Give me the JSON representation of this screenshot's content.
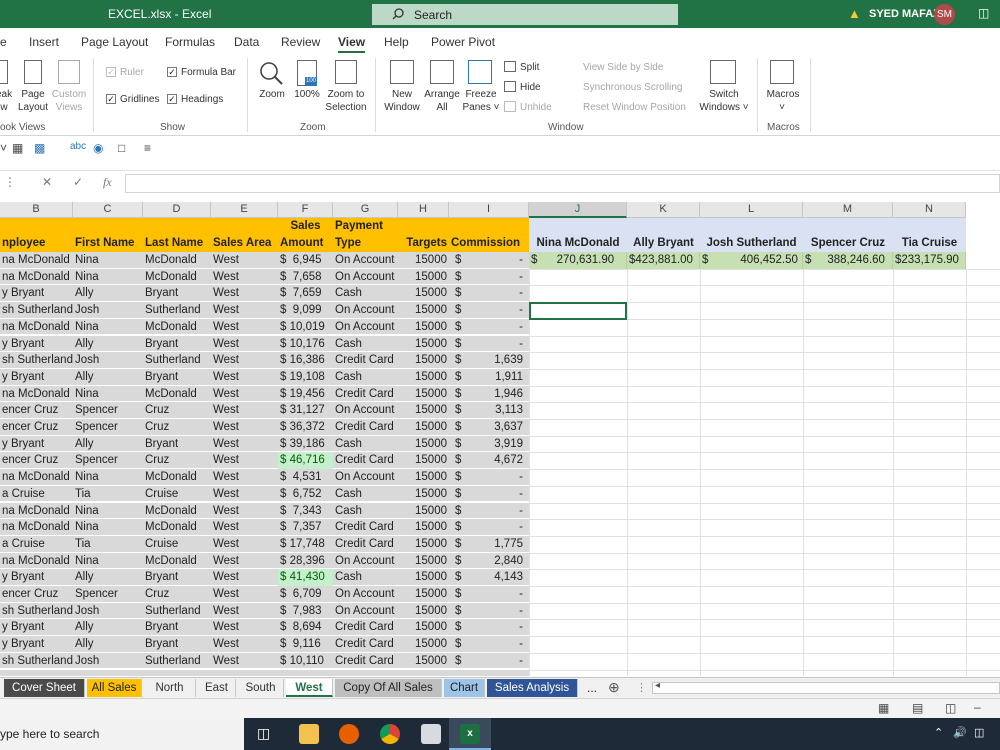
{
  "window": {
    "title": "EXCEL.xlsx  -  Excel",
    "search_placeholder": "Search",
    "user_name": "SYED MAFAZ",
    "user_initials": "SM"
  },
  "menu": [
    "e",
    "Insert",
    "Page Layout",
    "Formulas",
    "Data",
    "Review",
    "View",
    "Help",
    "Power Pivot"
  ],
  "ribbon": {
    "workbook_views": {
      "break_label": "eak\nw",
      "page_layout": "Page\nLayout",
      "custom_views": "Custom\nViews",
      "group": "ook Views"
    },
    "show": {
      "ruler": "Ruler",
      "formula_bar": "Formula Bar",
      "gridlines": "Gridlines",
      "headings": "Headings",
      "group": "Show"
    },
    "zoom": {
      "zoom": "Zoom",
      "hundred": "100%",
      "zoom_sel": "Zoom to\nSelection",
      "group": "Zoom"
    },
    "window": {
      "new_window": "New\nWindow",
      "arrange_all": "Arrange\nAll",
      "freeze": "Freeze\nPanes ˅",
      "split": "Split",
      "hide": "Hide",
      "unhide": "Unhide",
      "side_by_side": "View Side by Side",
      "sync_scroll": "Synchronous Scrolling",
      "reset_pos": "Reset Window Position",
      "switch": "Switch\nWindows ˅",
      "group": "Window"
    },
    "macros": {
      "macros": "Macros",
      "group": "Macros"
    }
  },
  "formula_bar": {
    "cancel": "✕",
    "enter": "✓",
    "fx": "fx"
  },
  "columns": [
    "B",
    "C",
    "D",
    "E",
    "F",
    "G",
    "H",
    "I",
    "J",
    "K",
    "L",
    "M",
    "N"
  ],
  "header1": {
    "sales": "Sales",
    "payment": "Payment"
  },
  "header2": [
    "nployee",
    "First Name",
    "Last Name",
    "Sales Area",
    "Amount",
    "Type",
    "Targets",
    "Commission"
  ],
  "summary": {
    "names": [
      "Nina McDonald",
      "Ally Bryant",
      "Josh Sutherland",
      "Spencer Cruz",
      "Tia Cruise"
    ],
    "values": [
      "$      270,631.90",
      "$423,881.00",
      "$          406,452.50",
      "$     388,246.60",
      "$233,175.90"
    ]
  },
  "rows": [
    [
      "na McDonald",
      "Nina",
      "McDonald",
      "West",
      "$  6,945",
      "On Account",
      "15000",
      "$",
      "-"
    ],
    [
      "na McDonald",
      "Nina",
      "McDonald",
      "West",
      "$  7,658",
      "On Account",
      "15000",
      "$",
      "-"
    ],
    [
      "y Bryant",
      "Ally",
      "Bryant",
      "West",
      "$  7,659",
      "Cash",
      "15000",
      "$",
      "-"
    ],
    [
      "sh Sutherland",
      "Josh",
      "Sutherland",
      "West",
      "$  9,099",
      "On Account",
      "15000",
      "$",
      "-"
    ],
    [
      "na McDonald",
      "Nina",
      "McDonald",
      "West",
      "$ 10,019",
      "On Account",
      "15000",
      "$",
      "-"
    ],
    [
      "y Bryant",
      "Ally",
      "Bryant",
      "West",
      "$ 10,176",
      "Cash",
      "15000",
      "$",
      "-"
    ],
    [
      "sh Sutherland",
      "Josh",
      "Sutherland",
      "West",
      "$ 16,386",
      "Credit Card",
      "15000",
      "$",
      "1,639"
    ],
    [
      "y Bryant",
      "Ally",
      "Bryant",
      "West",
      "$ 19,108",
      "Cash",
      "15000",
      "$",
      "1,911"
    ],
    [
      "na McDonald",
      "Nina",
      "McDonald",
      "West",
      "$ 19,456",
      "Credit Card",
      "15000",
      "$",
      "1,946"
    ],
    [
      "encer Cruz",
      "Spencer",
      "Cruz",
      "West",
      "$ 31,127",
      "On Account",
      "15000",
      "$",
      "3,113"
    ],
    [
      "encer Cruz",
      "Spencer",
      "Cruz",
      "West",
      "$ 36,372",
      "Credit Card",
      "15000",
      "$",
      "3,637"
    ],
    [
      "y Bryant",
      "Ally",
      "Bryant",
      "West",
      "$ 39,186",
      "Cash",
      "15000",
      "$",
      "3,919"
    ],
    [
      "encer Cruz",
      "Spencer",
      "Cruz",
      "West",
      "$ 46,716",
      "Credit Card",
      "15000",
      "$",
      "4,672"
    ],
    [
      "na McDonald",
      "Nina",
      "McDonald",
      "West",
      "$  4,531",
      "On Account",
      "15000",
      "$",
      "-"
    ],
    [
      "a Cruise",
      "Tia",
      "Cruise",
      "West",
      "$  6,752",
      "Cash",
      "15000",
      "$",
      "-"
    ],
    [
      "na McDonald",
      "Nina",
      "McDonald",
      "West",
      "$  7,343",
      "Cash",
      "15000",
      "$",
      "-"
    ],
    [
      "na McDonald",
      "Nina",
      "McDonald",
      "West",
      "$  7,357",
      "Credit Card",
      "15000",
      "$",
      "-"
    ],
    [
      "a Cruise",
      "Tia",
      "Cruise",
      "West",
      "$ 17,748",
      "Credit Card",
      "15000",
      "$",
      "1,775"
    ],
    [
      "na McDonald",
      "Nina",
      "McDonald",
      "West",
      "$ 28,396",
      "On Account",
      "15000",
      "$",
      "2,840"
    ],
    [
      "y Bryant",
      "Ally",
      "Bryant",
      "West",
      "$ 41,430",
      "Cash",
      "15000",
      "$",
      "4,143"
    ],
    [
      "encer Cruz",
      "Spencer",
      "Cruz",
      "West",
      "$  6,709",
      "On Account",
      "15000",
      "$",
      "-"
    ],
    [
      "sh Sutherland",
      "Josh",
      "Sutherland",
      "West",
      "$  7,983",
      "On Account",
      "15000",
      "$",
      "-"
    ],
    [
      "y Bryant",
      "Ally",
      "Bryant",
      "West",
      "$  8,694",
      "Credit Card",
      "15000",
      "$",
      "-"
    ],
    [
      "y Bryant",
      "Ally",
      "Bryant",
      "West",
      "$  9,116",
      "Credit Card",
      "15000",
      "$",
      "-"
    ],
    [
      "sh Sutherland",
      "Josh",
      "Sutherland",
      "West",
      "$ 10,110",
      "Credit Card",
      "15000",
      "$",
      "-"
    ]
  ],
  "highlighted_rows": [
    12,
    19
  ],
  "sheet_tabs": [
    {
      "label": "Cover Sheet",
      "style": "dark"
    },
    {
      "label": "All Sales",
      "style": "yellow"
    },
    {
      "label": "North",
      "style": "plain"
    },
    {
      "label": "East",
      "style": "plain"
    },
    {
      "label": "South",
      "style": "plain"
    },
    {
      "label": "West",
      "style": "active"
    },
    {
      "label": "Copy Of All Sales",
      "style": "gray"
    },
    {
      "label": "Chart",
      "style": "lightblue"
    },
    {
      "label": "Sales Analysis",
      "style": "blue"
    }
  ],
  "tabs_more": "...",
  "taskbar": {
    "search_text": "ype here to search"
  },
  "colors": {
    "excel_green": "#217346",
    "header_yellow": "#ffc000",
    "summary_blue": "#d9e1f2",
    "summary_green": "#c6e0b4",
    "row_gray": "#d9d9d9"
  }
}
